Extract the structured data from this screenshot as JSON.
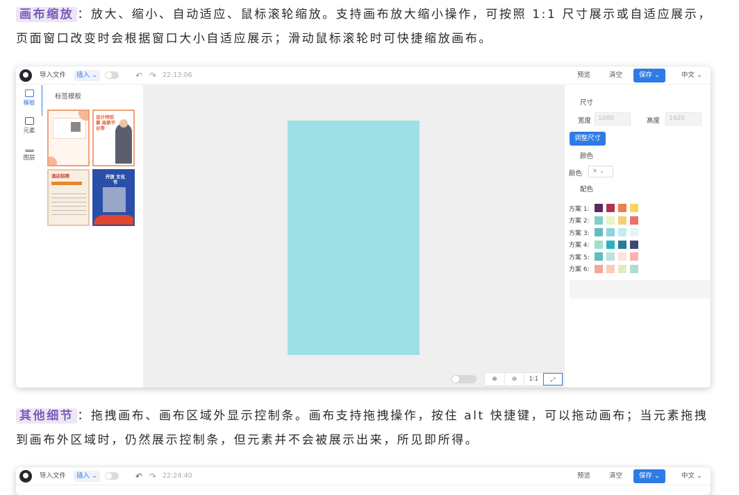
{
  "section1": {
    "highlight": "画布缩放",
    "text": "：放大、缩小、自动适应、鼠标滚轮缩放。支持画布放大缩小操作，可按照 1:1 尺寸展示或自适应展示，页面窗口改变时会根据窗口大小自适应展示；滑动鼠标滚轮时可快捷缩放画布。"
  },
  "section2": {
    "highlight": "其他细节",
    "text": "：拖拽画布、画布区域外显示控制条。画布支持拖拽操作，按住 alt 快捷键，可以拖动画布；当元素拖拽到画布外区域时，仍然展示控制条，但元素并不会被展示出来，所见即所得。"
  },
  "toolbar": {
    "import_label": "导入文件",
    "insert_label": "插入 ⌄",
    "timestamp": "22:13:06",
    "preview_label": "预览",
    "clear_label": "清空",
    "save_label": "保存 ⌄",
    "lang_label": "中文 ⌄"
  },
  "toolbar2": {
    "import_label": "导入文件",
    "insert_label": "插入 ⌄",
    "timestamp": "22:24:40",
    "preview_label": "预览",
    "clear_label": "清空",
    "save_label": "保存 ⌄",
    "lang_label": "中文 ⌄"
  },
  "leftnav": {
    "items": [
      {
        "label": "模板",
        "icon": "book-icon"
      },
      {
        "label": "元素",
        "icon": "image-icon"
      },
      {
        "label": "图层",
        "icon": "layers-icon"
      }
    ]
  },
  "templates": {
    "title": "标签模板",
    "cards": [
      {
        "text": ""
      },
      {
        "text": "设计师招募 高薪平台等"
      },
      {
        "text": "酒店招聘"
      },
      {
        "text": "开放 文化节"
      }
    ]
  },
  "zoom": {
    "zoom_in": "⊕",
    "zoom_out": "⊖",
    "one_to_one": "1:1",
    "fit": "⤢"
  },
  "properties": {
    "size_title": "尺寸",
    "width_label": "宽度",
    "width_value": "1080",
    "height_label": "高度",
    "height_value": "1920",
    "adjust_label": "调整尺寸",
    "color_title": "颜色",
    "color_label": "颜色",
    "color_select": "× ⌄",
    "palette_title": "配色",
    "schemes": [
      {
        "name": "方案 1:",
        "colors": [
          "#5b2a5a",
          "#b5314b",
          "#ee7d4f",
          "#f6d55c"
        ]
      },
      {
        "name": "方案 2:",
        "colors": [
          "#7fd1c4",
          "#e7f4c6",
          "#f5cf6f",
          "#ee6e6e"
        ]
      },
      {
        "name": "方案 3:",
        "colors": [
          "#5fbcc4",
          "#8fd3dc",
          "#c4ebf1",
          "#e2f7f9"
        ]
      },
      {
        "name": "方案 4:",
        "colors": [
          "#9ee0cf",
          "#2bb3c0",
          "#2a7a9a",
          "#3c4870"
        ]
      },
      {
        "name": "方案 5:",
        "colors": [
          "#5fbdbd",
          "#bfe0dc",
          "#fbe3df",
          "#f8b4b0"
        ]
      },
      {
        "name": "方案 6:",
        "colors": [
          "#f5a59e",
          "#f9cfb8",
          "#e6eabf",
          "#a9e0cc"
        ]
      }
    ]
  },
  "colors": {
    "accent": "#2d7be5",
    "highlight_bg": "#ece7f6",
    "highlight_text": "#7b5ab8",
    "canvas_fill": "#9fdfe6"
  }
}
